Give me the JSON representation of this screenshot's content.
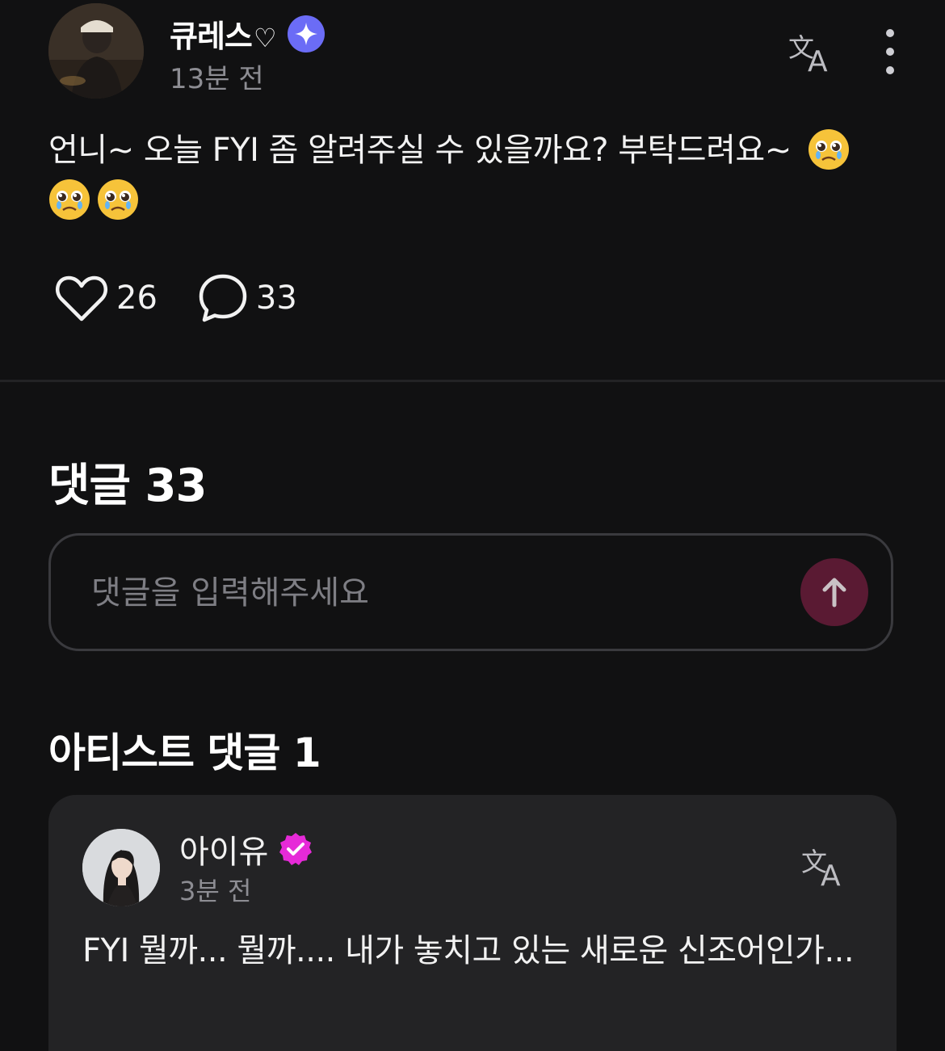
{
  "post": {
    "author": "큐레스",
    "author_suffix": "♡",
    "time": "13분 전",
    "body": "언니~ 오늘 FYI 좀 알려주실 수 있을까요? 부탁드려요~",
    "likes": "26",
    "comments": "33"
  },
  "comments_section": {
    "title": "댓글 33",
    "input_placeholder": "댓글을 입력해주세요"
  },
  "artist_section": {
    "title": "아티스트 댓글 1",
    "comment": {
      "author": "아이유",
      "time": "3분 전",
      "text": "FYI 뭘까... 뭘까.... 내가 놓치고 있는 새로운 신조어인가..."
    }
  },
  "icons": {
    "badge_fan": "sparkle-icon",
    "badge_artist": "verified-icon",
    "translate": "translate-icon",
    "more": "more-vertical-icon",
    "like": "heart-icon",
    "comment": "comment-icon",
    "send": "arrow-up-icon",
    "emoji": "pleading-face-emoji"
  },
  "colors": {
    "background": "#111112",
    "fan_badge": "#6b6cf6",
    "artist_badge": "#e62ad8",
    "send_button": "#5a1a33",
    "card": "#232325"
  }
}
